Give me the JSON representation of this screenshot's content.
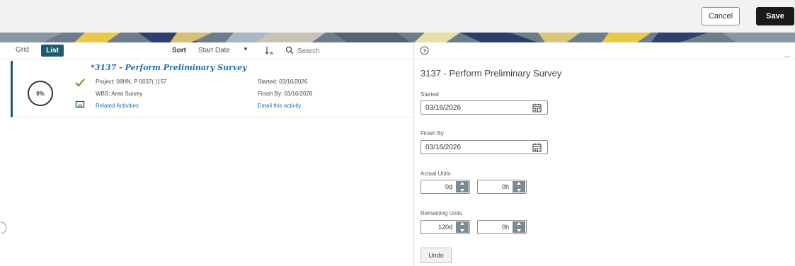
{
  "topbar": {
    "cancel_label": "Cancel",
    "save_label": "Save"
  },
  "list_toolbar": {
    "view_tabs": [
      "Grid",
      "List"
    ],
    "active_tab": "List",
    "sort_label": "Sort",
    "sort_value": "Start Date",
    "sort_caret": "▼",
    "search_placeholder": "Search"
  },
  "activity_card": {
    "title": "*3137 - Perform Preliminary Survey",
    "progress": "0%",
    "project": "Project: 08HN, P 0037( )157",
    "wbs": "WBS: Area Survey",
    "related_link": "Related Activities",
    "started": "Started: 03/16/2026",
    "finish_by": "Finish By: 03/16/2026",
    "email_link": "Email this activity"
  },
  "detail": {
    "title": "3137 - Perform Preliminary Survey",
    "started_label": "Started",
    "started_value": "03/16/2026",
    "finish_by_label": "Finish By",
    "finish_by_value": "03/16/2026",
    "actual_units_label": "Actual Units",
    "actual_units_days": "0d",
    "actual_units_hours": "0h",
    "remaining_units_label": "Remaining Units",
    "remaining_units_days": "120d",
    "remaining_units_hours": "0h",
    "undo_label": "Undo"
  },
  "colors": {
    "accent": "#1e5a6e",
    "link": "#1d6fb3",
    "save_button": "#1a1a1a",
    "check": "#6b9a3c",
    "stepper": "#7b8a90"
  },
  "icons": [
    "sort-direction-icon",
    "search-icon",
    "check-icon",
    "flag-icon",
    "circle-chevron-icon",
    "calendar-icon",
    "stepper-up-icon",
    "stepper-down-icon"
  ]
}
